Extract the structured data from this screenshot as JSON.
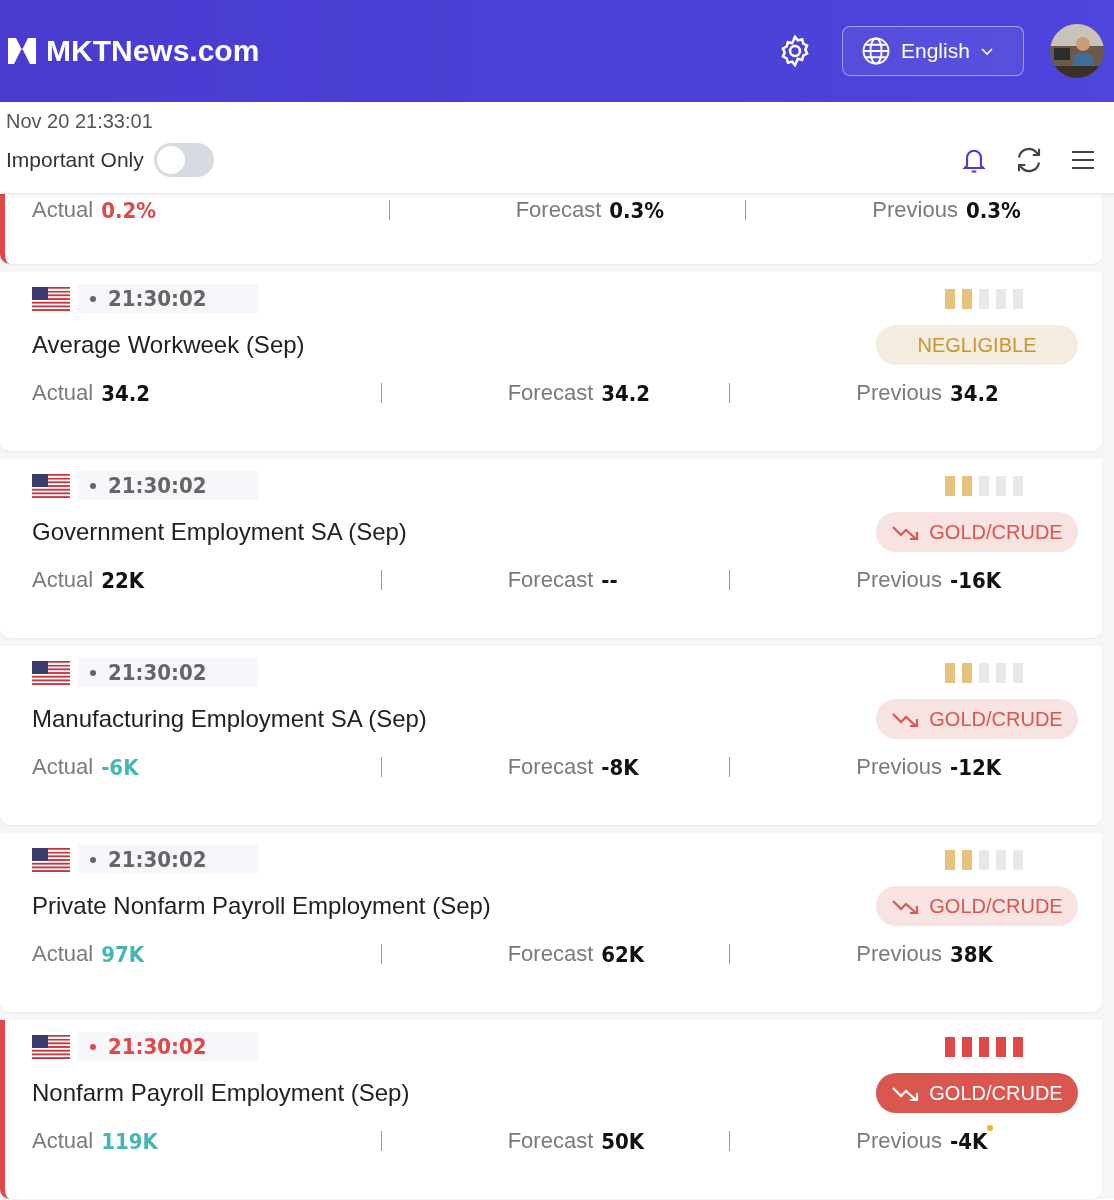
{
  "header": {
    "logo": "MKTNews.com",
    "language": "English"
  },
  "toolbar": {
    "datetime": "Nov 20 21:33:01",
    "filter_label": "Important Only",
    "filter_on": false
  },
  "events": [
    {
      "important": true,
      "values": [
        {
          "label": "Actual",
          "value": "0.2%",
          "color": "#e04848"
        },
        {
          "label": "Forecast",
          "value": "0.3%",
          "color": "#111111"
        },
        {
          "label": "Previous",
          "value": "0.3%",
          "color": "#111111"
        }
      ]
    },
    {
      "important": false,
      "time": "21:30:02",
      "stars": 2,
      "title": "Average Workweek (Sep)",
      "tag": {
        "kind": "negligible",
        "label": "NEGLIGIBLE"
      },
      "values": [
        {
          "label": "Actual",
          "value": "34.2",
          "color": "#111111"
        },
        {
          "label": "Forecast",
          "value": "34.2",
          "color": "#111111"
        },
        {
          "label": "Previous",
          "value": "34.2",
          "color": "#111111"
        }
      ]
    },
    {
      "important": false,
      "time": "21:30:02",
      "stars": 2,
      "title": "Government Employment SA (Sep)",
      "tag": {
        "kind": "bearish",
        "label": "GOLD/CRUDE"
      },
      "values": [
        {
          "label": "Actual",
          "value": "22K",
          "color": "#111111"
        },
        {
          "label": "Forecast",
          "value": "--",
          "color": "#111111"
        },
        {
          "label": "Previous",
          "value": "-16K",
          "color": "#111111"
        }
      ]
    },
    {
      "important": false,
      "time": "21:30:02",
      "stars": 2,
      "title": "Manufacturing Employment SA (Sep)",
      "tag": {
        "kind": "bearish",
        "label": "GOLD/CRUDE"
      },
      "values": [
        {
          "label": "Actual",
          "value": "-6K",
          "color": "#45b5b5"
        },
        {
          "label": "Forecast",
          "value": "-8K",
          "color": "#111111"
        },
        {
          "label": "Previous",
          "value": "-12K",
          "color": "#111111"
        }
      ]
    },
    {
      "important": false,
      "time": "21:30:02",
      "stars": 2,
      "title": "Private Nonfarm Payroll Employment (Sep)",
      "tag": {
        "kind": "bearish",
        "label": "GOLD/CRUDE"
      },
      "values": [
        {
          "label": "Actual",
          "value": "97K",
          "color": "#45b5b5"
        },
        {
          "label": "Forecast",
          "value": "62K",
          "color": "#111111"
        },
        {
          "label": "Previous",
          "value": "38K",
          "color": "#111111"
        }
      ]
    },
    {
      "important": true,
      "time": "21:30:02",
      "stars": 5,
      "title": "Nonfarm Payroll Employment (Sep)",
      "tag": {
        "kind": "bearish",
        "label": "GOLD/CRUDE"
      },
      "values": [
        {
          "label": "Actual",
          "value": "119K",
          "color": "#45b5b5"
        },
        {
          "label": "Forecast",
          "value": "50K",
          "color": "#111111"
        },
        {
          "label": "Previous",
          "value": "-4K",
          "color": "#111111",
          "revised": true
        }
      ]
    }
  ]
}
